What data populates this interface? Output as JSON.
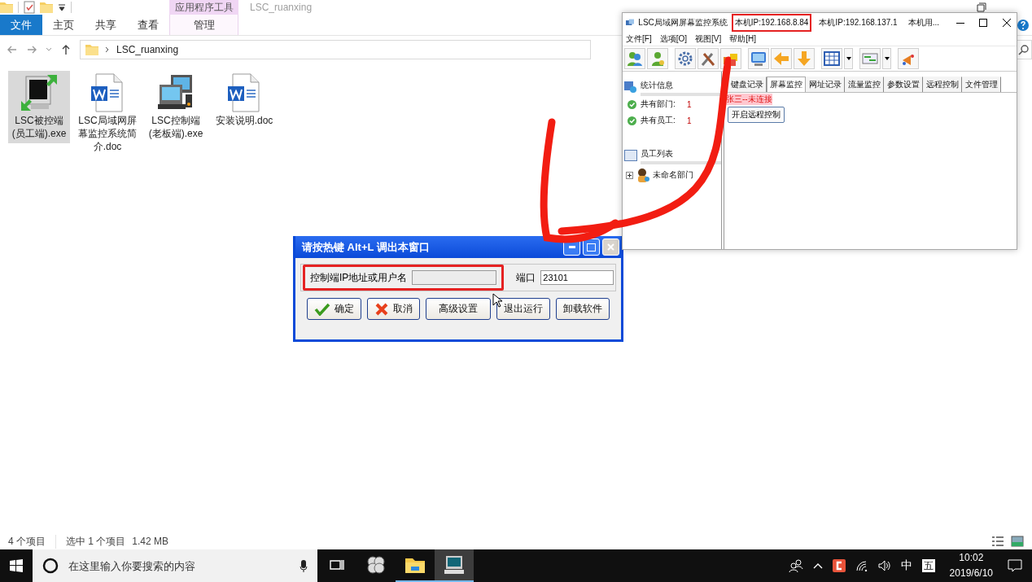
{
  "explorer": {
    "title": "LSC_ruanxing",
    "context_group": "应用程序工具",
    "ribbon_tabs": [
      {
        "label": "文件",
        "kind": "file"
      },
      {
        "label": "主页",
        "kind": "tab"
      },
      {
        "label": "共享",
        "kind": "tab"
      },
      {
        "label": "查看",
        "kind": "tab"
      },
      {
        "label": "管理",
        "kind": "context"
      }
    ],
    "address_path": "LSC_ruanxing",
    "files": [
      {
        "name": "LSC被控端(员工端).exe",
        "kind": "monitor-app",
        "selected": true
      },
      {
        "name": "LSC局域网屏幕监控系统简介.doc",
        "kind": "word-doc",
        "selected": false
      },
      {
        "name": "LSC控制端(老板端).exe",
        "kind": "computers-app",
        "selected": false
      },
      {
        "name": "安装说明.doc",
        "kind": "word-doc",
        "selected": false
      }
    ],
    "status_bar": {
      "item_count": "4 个项目",
      "selection": "选中 1 个项目",
      "size": "1.42 MB"
    }
  },
  "lsc_window": {
    "title": "LSC局域网屏幕监控系统",
    "ip_labels": [
      {
        "text": "本机IP:192.168.8.84",
        "highlighted": true
      },
      {
        "text": "本机IP:192.168.137.1",
        "highlighted": false
      },
      {
        "text": "本机用...",
        "highlighted": false
      }
    ],
    "menu": [
      "文件[F]",
      "选项[O]",
      "视图[V]",
      "帮助[H]"
    ],
    "stats": {
      "title": "统计信息",
      "items": [
        {
          "label": "共有部门:",
          "value": "1"
        },
        {
          "label": "共有员工:",
          "value": "1"
        }
      ]
    },
    "employee_list": {
      "title": "员工列表",
      "tree": [
        {
          "label": "未命名部门",
          "expanded": false
        }
      ]
    },
    "tabs": [
      {
        "label": "键盘记录",
        "selected": false
      },
      {
        "label": "屏幕监控",
        "selected": true
      },
      {
        "label": "网址记录",
        "selected": false
      },
      {
        "label": "流量监控",
        "selected": false
      },
      {
        "label": "参数设置",
        "selected": false
      },
      {
        "label": "远程控制",
        "selected": false
      },
      {
        "label": "文件管理",
        "selected": false
      }
    ],
    "connection_status": "张三--未连接",
    "action_button": "开启远程控制"
  },
  "dialog": {
    "title": "请按热键 Alt+L 调出本窗口",
    "fields": [
      {
        "label": "控制端IP地址或用户名",
        "highlighted": true
      },
      {
        "label": "端口",
        "value": "23101",
        "highlighted": false
      }
    ],
    "buttons": [
      {
        "label": "确定",
        "kind": "ok"
      },
      {
        "label": "取消",
        "kind": "cancel"
      },
      {
        "label": "高级设置",
        "kind": "plain"
      },
      {
        "label": "退出运行",
        "kind": "plain"
      },
      {
        "label": "卸载软件",
        "kind": "plain"
      }
    ]
  },
  "annotation": {
    "kind": "arrow"
  },
  "taskbar": {
    "search_placeholder": "在这里输入你要搜索的内容",
    "apps": [
      {
        "kind": "task-view",
        "running": false,
        "active": false
      },
      {
        "kind": "pinwheel",
        "running": false,
        "active": false
      },
      {
        "kind": "explorer",
        "running": true,
        "active": false
      },
      {
        "kind": "monitor",
        "running": true,
        "active": true
      }
    ],
    "input_mode": "中",
    "ime_mode": "五",
    "time": "10:02",
    "date": "2019/6/10"
  }
}
